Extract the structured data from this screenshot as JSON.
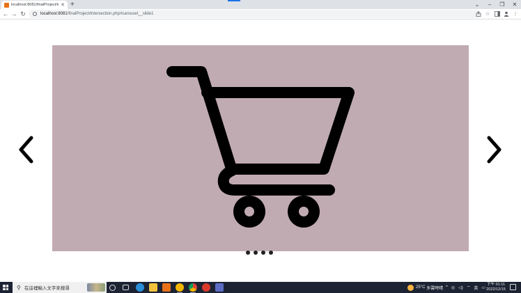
{
  "browser": {
    "tab": {
      "title": "localhost:8081/finalProject/in",
      "close_glyph": "✕"
    },
    "new_tab_glyph": "+",
    "window_controls": {
      "chevron": "⌄",
      "minimize": "–",
      "restore": "❐",
      "close": "✕"
    },
    "nav": {
      "back": "←",
      "forward": "→",
      "reload": "↻"
    },
    "address": {
      "host": "localhost:8081",
      "path": "/finalProject/intersection.php#carousel__slide1"
    },
    "toolbar_icons": [
      "share-icon",
      "star-icon",
      "sidepanel-icon",
      "profile-icon",
      "menu-icon"
    ]
  },
  "carousel": {
    "slide_background": "#c1abb3",
    "slide_icon": "shopping-cart-icon",
    "prev_label": "❮",
    "next_label": "❯",
    "indicators": [
      {
        "slide": 1,
        "active": true
      },
      {
        "slide": 2,
        "active": false
      },
      {
        "slide": 3,
        "active": false
      },
      {
        "slide": 4,
        "active": false
      }
    ]
  },
  "taskbar": {
    "search_placeholder": "在這裡輸入文字來搜尋",
    "weather": {
      "temp": "25°C",
      "desc": "多雲時晴"
    },
    "ime": "英",
    "clock": {
      "time": "下午 01:11",
      "date": "2022/12/15"
    },
    "apps": [
      "cortana-icon",
      "task-view-icon",
      "edge-icon",
      "file-explorer-icon",
      "store-icon",
      "chrome-canary-icon",
      "chrome-icon",
      "app-red-icon",
      "app-figure-icon"
    ]
  }
}
